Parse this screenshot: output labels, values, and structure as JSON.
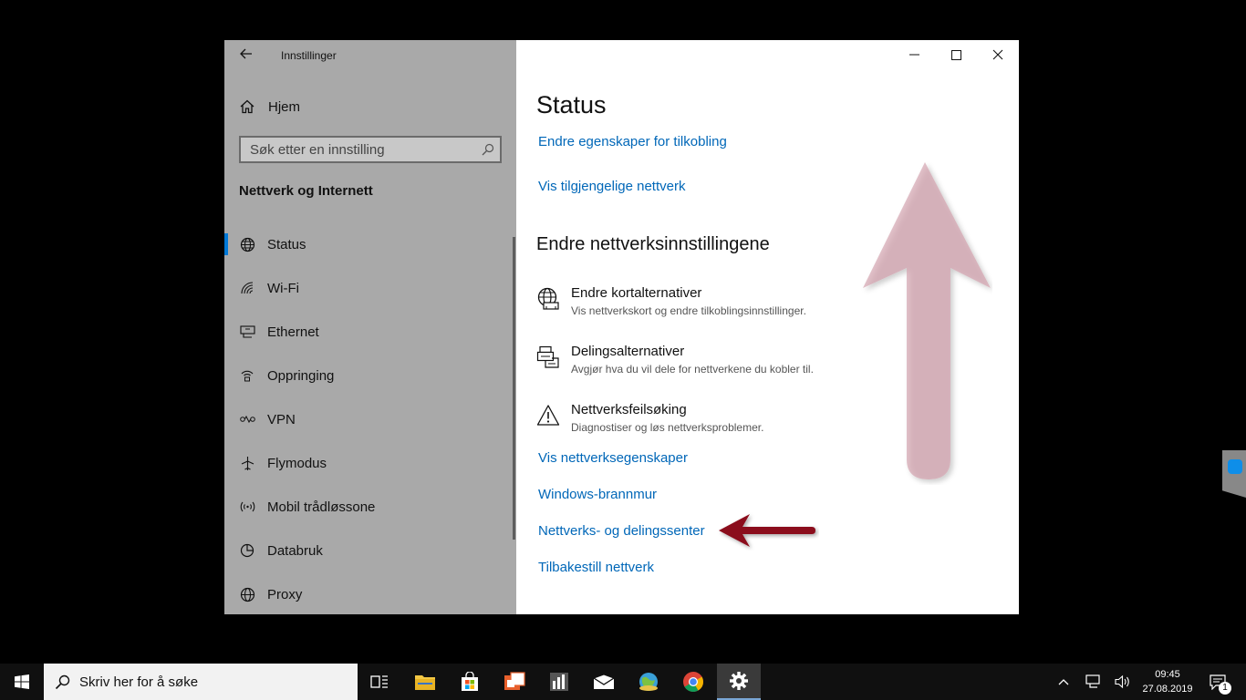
{
  "window": {
    "app_title": "Innstillinger",
    "home_label": "Hjem",
    "search_placeholder": "Søk etter en innstilling",
    "section_title": "Nettverk og Internett",
    "nav_items": [
      {
        "label": "Status",
        "icon": "globe-icon",
        "active": true
      },
      {
        "label": "Wi-Fi",
        "icon": "wifi-icon"
      },
      {
        "label": "Ethernet",
        "icon": "ethernet-icon"
      },
      {
        "label": "Oppringing",
        "icon": "dialup-icon"
      },
      {
        "label": "VPN",
        "icon": "vpn-icon"
      },
      {
        "label": "Flymodus",
        "icon": "airplane-icon"
      },
      {
        "label": "Mobil trådløssone",
        "icon": "hotspot-icon"
      },
      {
        "label": "Databruk",
        "icon": "data-usage-icon"
      },
      {
        "label": "Proxy",
        "icon": "globe-icon"
      }
    ]
  },
  "main": {
    "title": "Status",
    "links_top": [
      "Endre egenskaper for tilkobling",
      "Vis tilgjengelige nettverk"
    ],
    "section_heading": "Endre nettverksinnstillingene",
    "options": [
      {
        "title": "Endre kortalternativer",
        "subtitle": "Vis nettverkskort og endre tilkoblingsinnstillinger.",
        "icon": "adapter-globe-icon"
      },
      {
        "title": "Delingsalternativer",
        "subtitle": "Avgjør hva du vil dele for nettverkene du kobler til.",
        "icon": "sharing-icon"
      },
      {
        "title": "Nettverksfeilsøking",
        "subtitle": "Diagnostiser og løs nettverksproblemer.",
        "icon": "warning-icon"
      }
    ],
    "links_bottom": [
      "Vis nettverksegenskaper",
      "Windows-brannmur",
      "Nettverks- og delingssenter",
      "Tilbakestill nettverk"
    ]
  },
  "colors": {
    "accent": "#0078d7",
    "link": "#0067b8",
    "sidebar_bg": "#a9a9a9",
    "arrow_pink": "#c98d9a",
    "arrow_red": "#8b0f1f"
  },
  "taskbar": {
    "search_placeholder": "Skriv her for å søke",
    "time": "09:45",
    "date": "27.08.2019",
    "notification_count": "1"
  }
}
